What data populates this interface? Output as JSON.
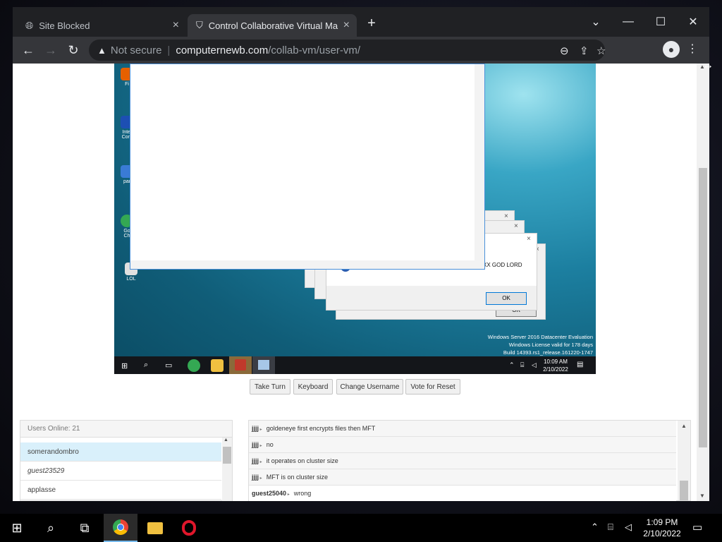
{
  "browser": {
    "tabs": [
      {
        "label": "Site Blocked",
        "active": false
      },
      {
        "label": "Control Collaborative Virtual Ma",
        "active": true
      }
    ],
    "new_tab": "+",
    "window_controls": {
      "minimize": "—",
      "maximize": "☐",
      "close": "✕",
      "tab_search": "⌄"
    },
    "address": {
      "security_label": "Not secure",
      "host": "computernewb.com",
      "path": "/collab-vm/user-vm/"
    }
  },
  "vm": {
    "desktop_icons": [
      {
        "label": "Fi",
        "color": "#e66000"
      },
      {
        "label": "Intel\nCom",
        "color": "#1d4fb3"
      },
      {
        "label": "par",
        "color": "#3a7bd5"
      },
      {
        "label": "Go\nCh",
        "color": "#34a853"
      },
      {
        "label": "LOL",
        "color": "#e0e0e0"
      }
    ],
    "dialog_text": "XX GOD LORD",
    "ok_label": "OK",
    "ok_label_back": "OK",
    "license_lines": [
      "Windows Server 2016 Datacenter Evaluation",
      "Windows License valid for 178 days",
      "Build 14393.rs1_release.161220-1747"
    ],
    "clock_time": "10:09 AM",
    "clock_date": "2/10/2022"
  },
  "controls": {
    "take_turn": "Take Turn",
    "keyboard": "Keyboard",
    "change_username": "Change Username",
    "vote_reset": "Vote for Reset"
  },
  "users": {
    "header": "Users Online: 21",
    "list": [
      "somerandombro",
      "guest23529",
      "applasse"
    ]
  },
  "chat": {
    "messages": [
      {
        "user": "jjjj",
        "text": "goldeneye first encrypts files then MFT"
      },
      {
        "user": "jjjj",
        "text": "no"
      },
      {
        "user": "jjjj",
        "text": "it operates on cluster size"
      },
      {
        "user": "jjjj",
        "text": "MFT is on cluster size"
      },
      {
        "user": "guest25040",
        "text": "wrong"
      }
    ]
  },
  "host": {
    "clock_time": "1:09 PM",
    "clock_date": "2/10/2022"
  }
}
